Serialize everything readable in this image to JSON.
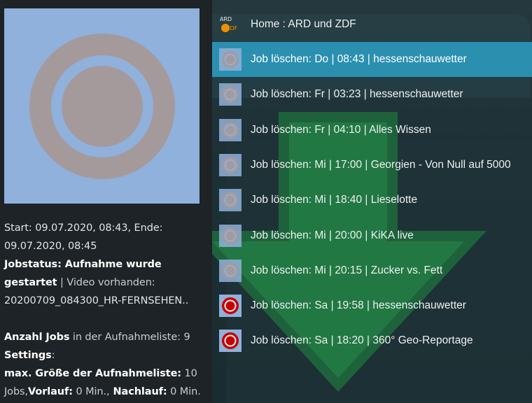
{
  "info": {
    "line1": "Start: 09.07.2020, 08:43, Ende:",
    "line2": "09.07.2020, 08:45",
    "jobstatus_label": " Jobstatus: Aufnahme wurde",
    "jobstatus_label2": "gestartet",
    "video_label": " | Video vorhanden:",
    "video_file": "20200709_084300_HR-FERNSEHEN..",
    "anzahl_label": "Anzahl Jobs",
    "anzahl_text": " in der Aufnahmeliste: 9",
    "settings_label": "Settings",
    "settings_colon": ":",
    "maxgroesse_label": "max. Größe der Aufnahmeliste:",
    "maxgroesse_value": " 10",
    "jobs_text": "Jobs,",
    "vorlauf_label": "Vorlauf:",
    "vorlauf_value": " 0 Min.,",
    "nachlauf_label": " Nachlauf:",
    "nachlauf_value": " 0 Min."
  },
  "header": {
    "logo_text_top": "ARD",
    "logo_text_bottom": "ZDF",
    "title": "Home : ARD und ZDF"
  },
  "jobs": [
    {
      "label": "Job löschen: Do | 08:43 | hessenschauwetter",
      "icon": "record-icon-inactive",
      "selected": true
    },
    {
      "label": "Job löschen: Fr | 03:23 | hessenschauwetter",
      "icon": "record-icon-inactive",
      "selected": false
    },
    {
      "label": "Job löschen: Fr | 04:10 | Alles Wissen",
      "icon": "record-icon-inactive",
      "selected": false
    },
    {
      "label": "Job löschen: Mi | 17:00 | Georgien - Von Null auf 5000",
      "icon": "record-icon-inactive",
      "selected": false
    },
    {
      "label": "Job löschen: Mi | 18:40 | Lieselotte",
      "icon": "record-icon-inactive",
      "selected": false
    },
    {
      "label": "Job löschen: Mi | 20:00 | KiKA live",
      "icon": "record-icon-inactive",
      "selected": false
    },
    {
      "label": "Job löschen: Mi | 20:15 | Zucker vs. Fett",
      "icon": "record-icon-inactive",
      "selected": false
    },
    {
      "label": "Job löschen: Sa | 19:58 | hessenschauwetter",
      "icon": "record-icon-active",
      "selected": false
    },
    {
      "label": "Job löschen: Sa | 18:20 | 360° Geo-Reportage",
      "icon": "record-icon-active",
      "selected": false
    }
  ],
  "colors": {
    "selected_row": "#2b8fb0",
    "thumb_bg": "#8fb1db",
    "ring": "#a49a9c",
    "record_active": "#c80000"
  }
}
